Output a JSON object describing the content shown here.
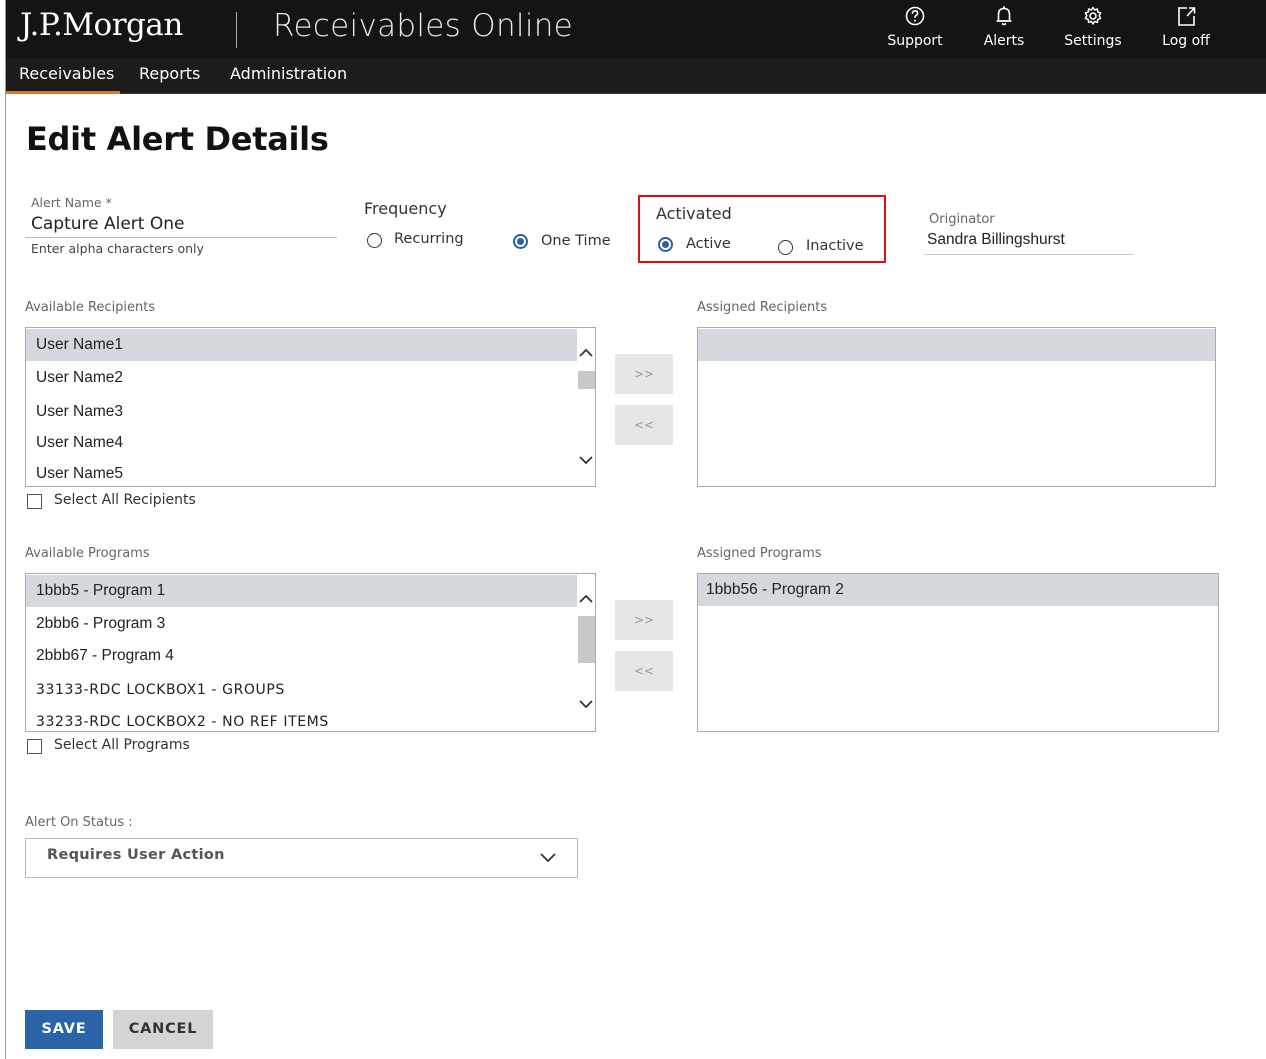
{
  "header": {
    "brand": "J.P.Morgan",
    "app_title": "Receivables Online",
    "utilities": [
      {
        "label": "Support",
        "icon": "help-circle-icon"
      },
      {
        "label": "Alerts",
        "icon": "bell-icon"
      },
      {
        "label": "Settings",
        "icon": "gear-icon"
      },
      {
        "label": "Log off",
        "icon": "external-link-icon"
      }
    ]
  },
  "nav": {
    "items": [
      "Receivables",
      "Reports",
      "Administration"
    ],
    "active": "Receivables",
    "accent_color": "#d8782c"
  },
  "page": {
    "title": "Edit Alert Details"
  },
  "alert_name": {
    "label": "Alert Name *",
    "value": "Capture Alert One",
    "hint": "Enter alpha characters only"
  },
  "frequency": {
    "label": "Frequency",
    "options": [
      "Recurring",
      "One Time"
    ],
    "selected": "One Time"
  },
  "activated": {
    "label": "Activated",
    "options": [
      "Active",
      "Inactive"
    ],
    "selected": "Active",
    "highlight_color": "#d9121b"
  },
  "originator": {
    "label": "Originator",
    "value": "Sandra Billingshurst"
  },
  "recipients": {
    "available_label": "Available Recipients",
    "assigned_label": "Assigned Recipients",
    "available": [
      "User Name1",
      "User Name2",
      "User Name3",
      "User Name4",
      "User Name5"
    ],
    "assigned": [],
    "select_all_label": "Select All Recipients",
    "add_label": ">>",
    "remove_label": "<<"
  },
  "programs": {
    "available_label": "Available Programs",
    "assigned_label": "Assigned Programs",
    "available": [
      "1bbb5 - Program 1",
      "2bbb6 - Program 3",
      "2bbb67 - Program 4",
      "33133-RDC LOCKBOX1 - GROUPS",
      "33233-RDC LOCKBOX2 - NO REF ITEMS"
    ],
    "assigned": [
      "1bbb56 - Program 2"
    ],
    "select_all_label": "Select All Programs",
    "add_label": ">>",
    "remove_label": "<<"
  },
  "alert_status": {
    "label": "Alert On Status :",
    "value": "Requires User Action"
  },
  "actions": {
    "save_label": "SAVE",
    "cancel_label": "CANCEL",
    "primary_color": "#2a64a6"
  }
}
